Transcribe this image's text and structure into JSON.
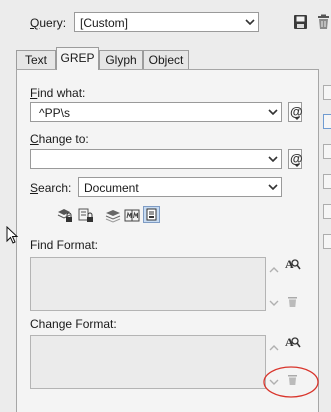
{
  "query": {
    "label": "Query:",
    "value": "[Custom]"
  },
  "tabs": [
    {
      "label": "Text",
      "active": false
    },
    {
      "label": "GREP",
      "active": true
    },
    {
      "label": "Glyph",
      "active": false
    },
    {
      "label": "Object",
      "active": false
    }
  ],
  "find_what": {
    "label": "Find what:",
    "value": "^PP\\s"
  },
  "change_to": {
    "label": "Change to:",
    "value": ""
  },
  "search": {
    "label": "Search:",
    "value": "Document"
  },
  "find_format": {
    "label": "Find Format:"
  },
  "change_format": {
    "label": "Change Format:"
  },
  "icons": {
    "save_query": "save-icon",
    "delete_query": "trash-icon",
    "special_characters": "at-icon",
    "include_locked_layers": "locked-layers-icon",
    "include_locked_stories": "locked-stories-icon",
    "include_hidden_layers": "hidden-layers-icon",
    "include_master_pages": "master-pages-icon",
    "include_footnotes": "footnotes-icon",
    "specify_attributes": "find-attributes-icon",
    "clear_attributes": "trash-icon"
  },
  "colors": {
    "annotation_circle": "#d9342b",
    "selected_toggle": "#c7dbf2"
  }
}
